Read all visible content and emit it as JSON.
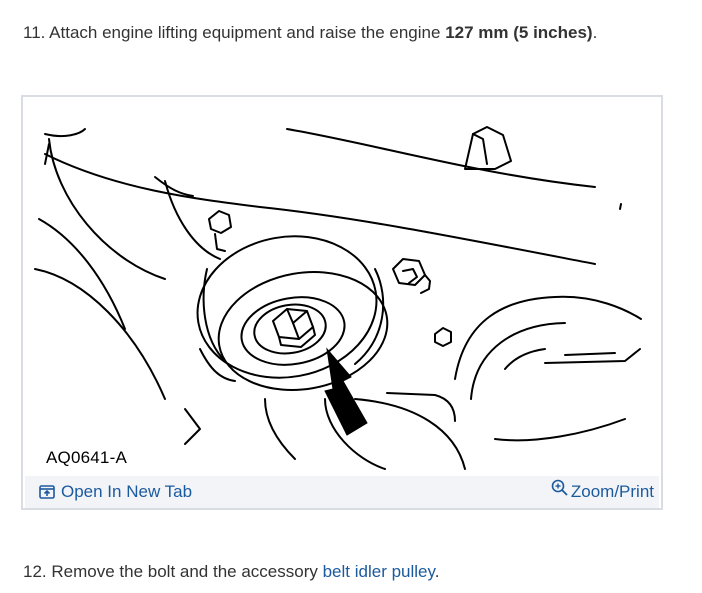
{
  "step11": {
    "number": "11.",
    "text_before": "Attach engine lifting equipment and raise the engine",
    "bold": "127 mm (5 inches)",
    "text_after": "."
  },
  "figure": {
    "caption": "AQ0641-A",
    "open_label": "Open In New Tab",
    "zoom_label": "Zoom/Print",
    "open_icon": "open-new-tab-icon",
    "zoom_icon": "zoom-icon"
  },
  "step12": {
    "number": "12.",
    "text_before": "Remove the bolt and the accessory",
    "link": "belt idler pulley",
    "text_after": "."
  },
  "colors": {
    "link": "#1c5a9e",
    "toolbar_bg": "#f2f4f8",
    "frame_border": "#d9dde3",
    "text": "#333333"
  }
}
